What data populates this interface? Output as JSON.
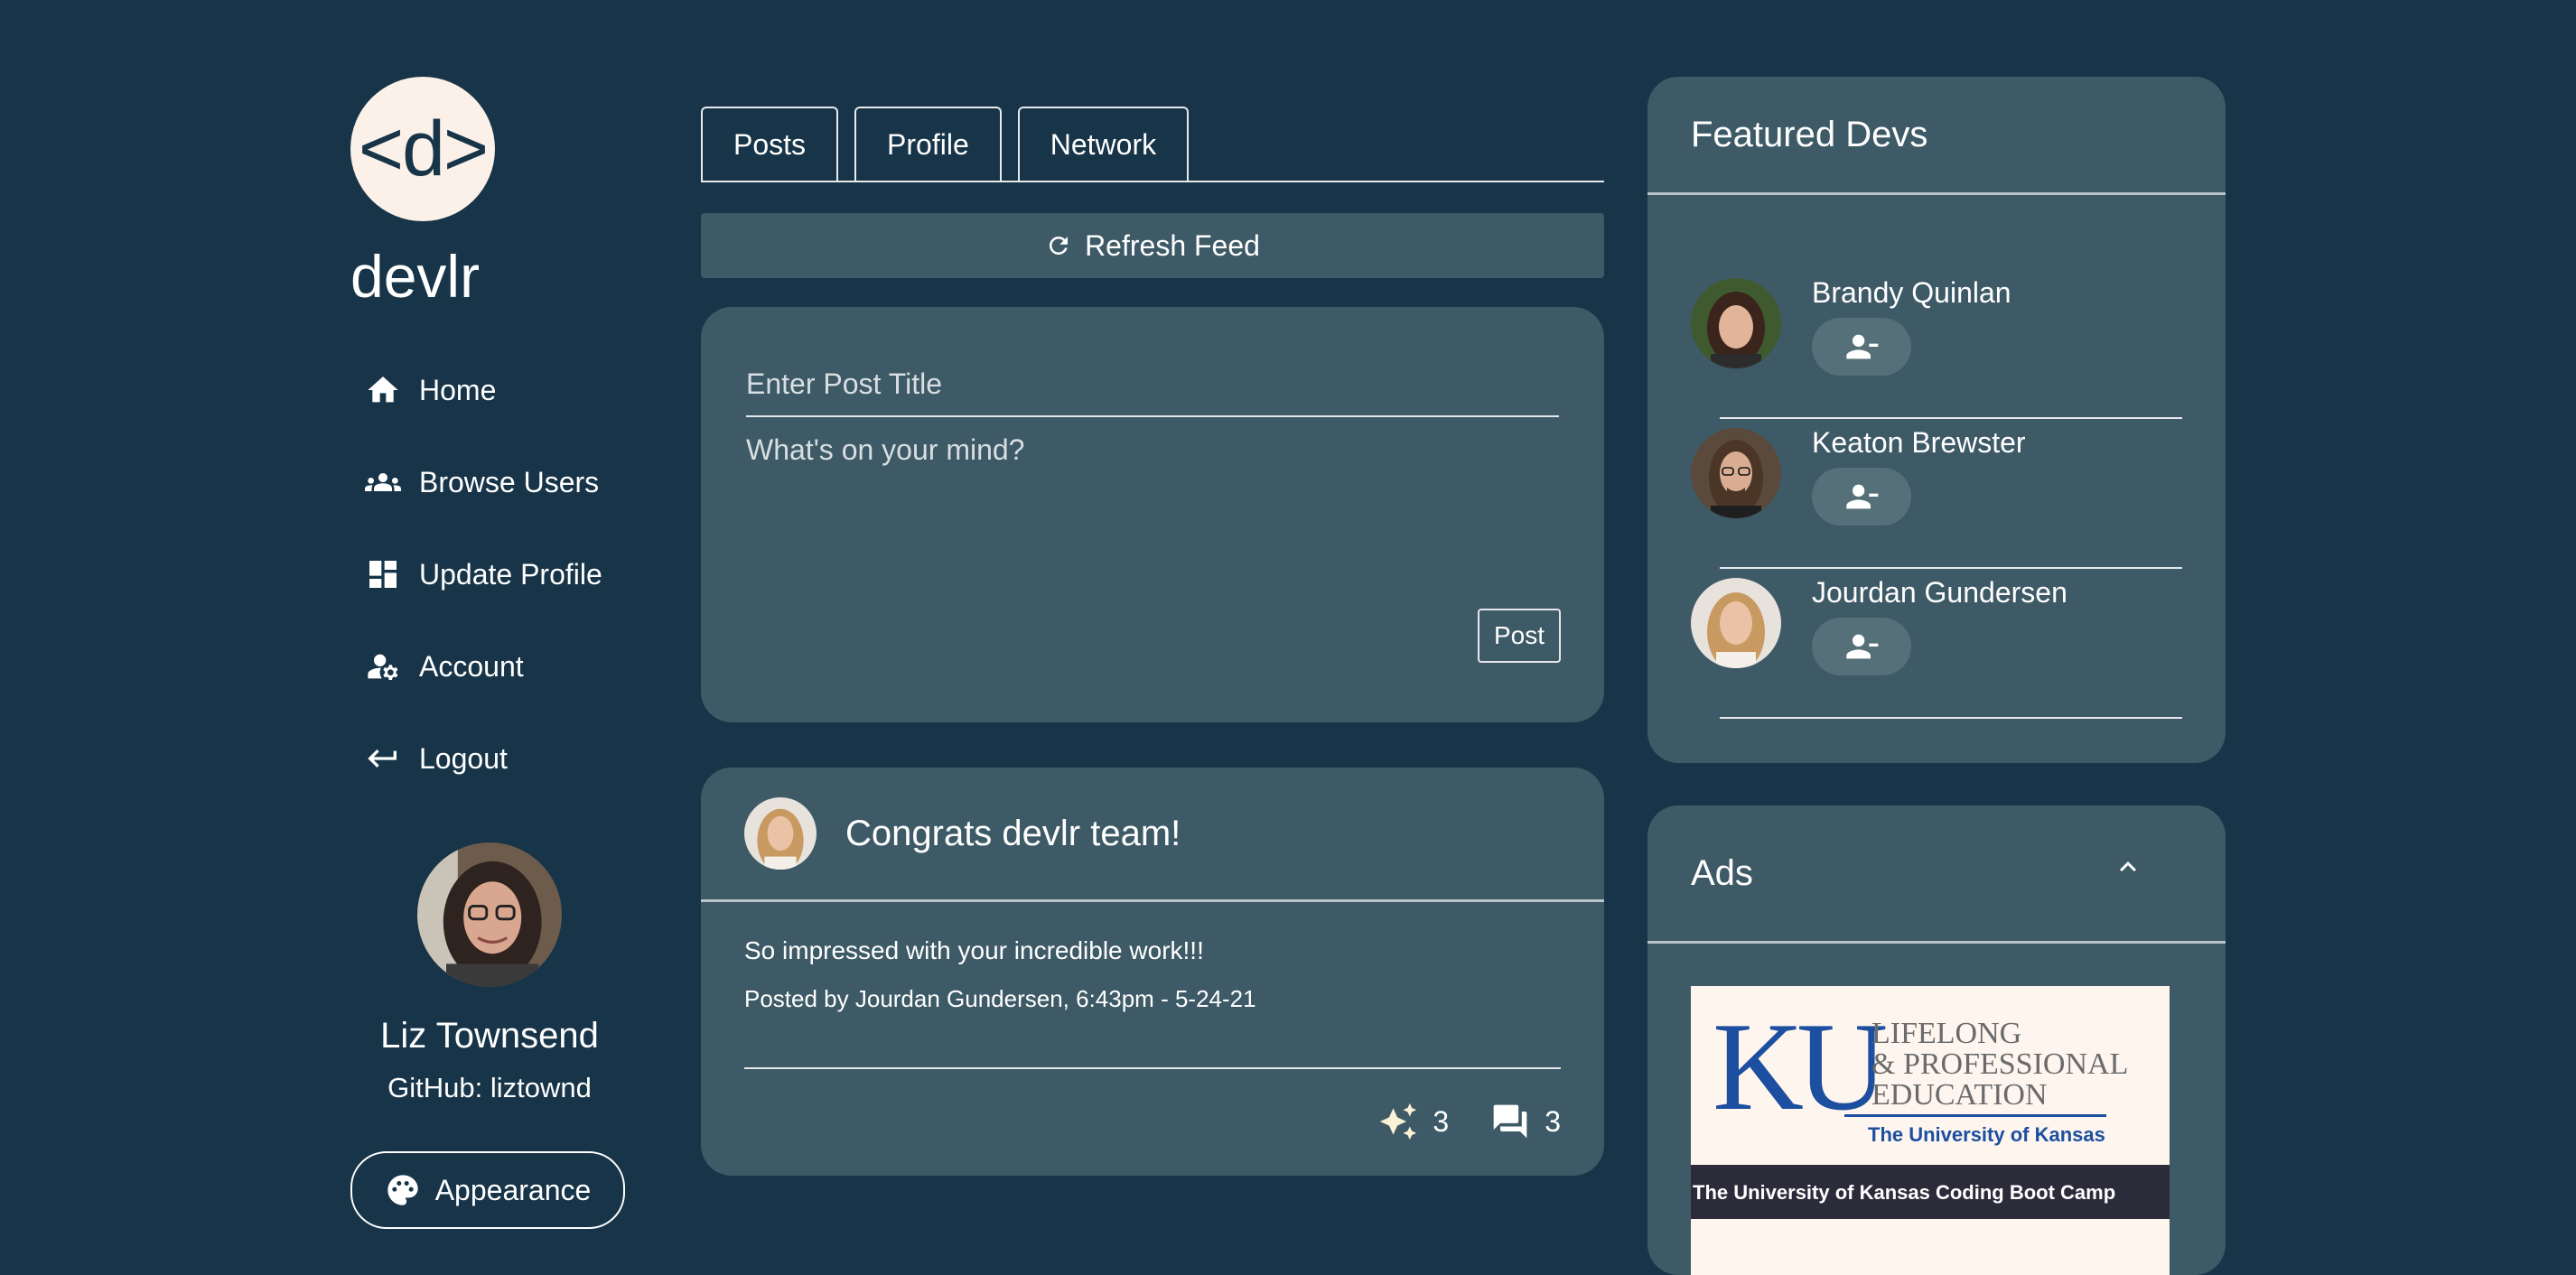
{
  "app": {
    "logo_text": "<d>",
    "brand_name": "devlr"
  },
  "sidebar": {
    "nav": [
      {
        "label": "Home",
        "icon": "home-icon"
      },
      {
        "label": "Browse Users",
        "icon": "group-icon"
      },
      {
        "label": "Update Profile",
        "icon": "dashboard-icon"
      },
      {
        "label": "Account",
        "icon": "manage-account-icon"
      },
      {
        "label": "Logout",
        "icon": "keyboard-return-icon"
      }
    ],
    "user": {
      "name": "Liz Townsend",
      "github": "GitHub: liztownd"
    },
    "appearance_label": "Appearance"
  },
  "tabs": [
    {
      "label": "Posts"
    },
    {
      "label": "Profile"
    },
    {
      "label": "Network"
    }
  ],
  "refresh_label": "Refresh Feed",
  "composer": {
    "title_placeholder": "Enter Post Title",
    "body_placeholder": "What's on your mind?",
    "post_label": "Post"
  },
  "post": {
    "title": "Congrats devlr team!",
    "body": "So impressed with your incredible work!!!",
    "meta": "Posted by Jourdan Gundersen, 6:43pm - 5-24-21",
    "sparkle_count": "3",
    "comment_count": "3"
  },
  "featured": {
    "title": "Featured Devs",
    "devs": [
      {
        "name": "Brandy Quinlan"
      },
      {
        "name": "Keaton Brewster"
      },
      {
        "name": "Jourdan Gundersen"
      }
    ]
  },
  "ads": {
    "title": "Ads",
    "ku_letters": "KU",
    "ku_line1": "LIFELONG",
    "ku_line2": "& PROFESSIONAL",
    "ku_line3": "EDUCATION",
    "ku_university": "The University of Kansas",
    "ku_band": "The University of Kansas Coding Boot Camp"
  },
  "colors": {
    "background": "#173448",
    "card": "#3e5a67",
    "logo_bg": "#fbf1e8",
    "sparkle": "#fbf1d6"
  }
}
